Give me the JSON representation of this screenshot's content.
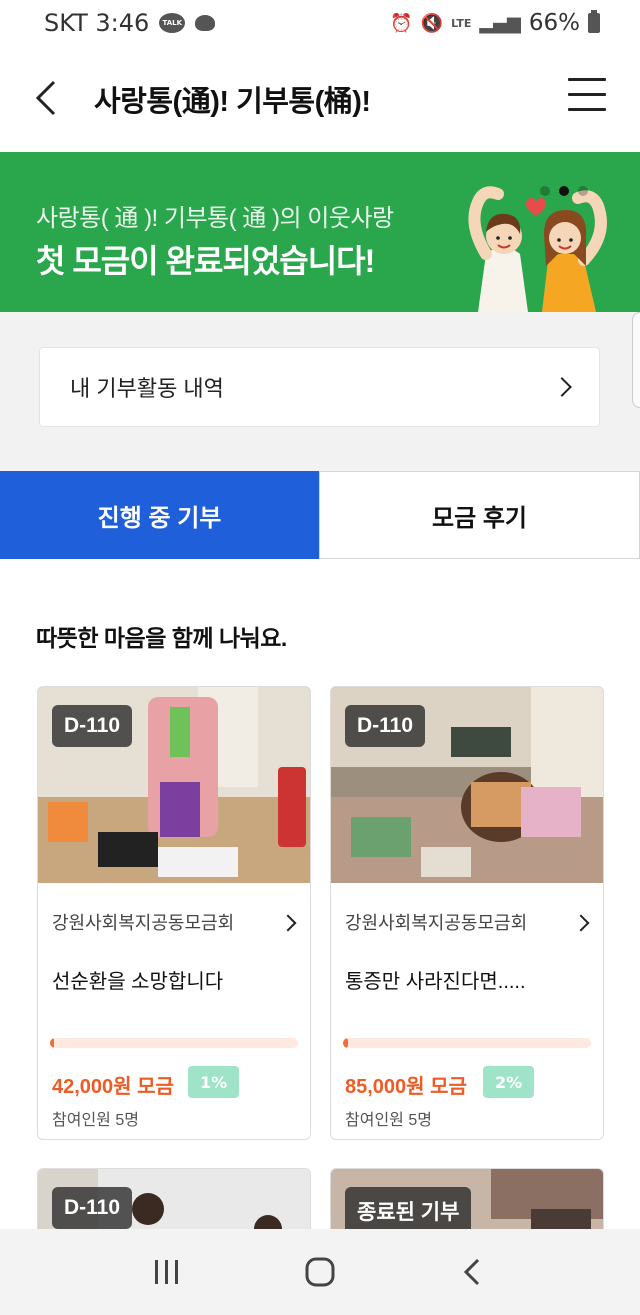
{
  "status_bar": {
    "carrier_time": "SKT 3:46",
    "talk_badge": "TALK",
    "network": "LTE",
    "battery": "66%"
  },
  "header": {
    "title": "사랑통(通)! 기부통(桶)!"
  },
  "banner": {
    "subtitle": "사랑통( 通 )! 기부통( 通 )의 이웃사랑",
    "headline": "첫 모금이 완료되었습니다!",
    "dots_total": 3,
    "dots_active": 2
  },
  "history": {
    "label": "내 기부활동 내역"
  },
  "tabs": [
    {
      "label": "진행 중 기부",
      "active": true
    },
    {
      "label": "모금 후기",
      "active": false
    }
  ],
  "section": {
    "title": "따뜻한 마음을 함께 나눠요."
  },
  "cards": [
    {
      "badge": "D-110",
      "org": "강원사회복지공동모금회",
      "title": "선순환을 소망합니다",
      "progress_fraction": 0.01,
      "amount": "42,000원 모금",
      "percent": "1%",
      "participants": "참여인원 5명"
    },
    {
      "badge": "D-110",
      "org": "강원사회복지공동모금회",
      "title": "통증만 사라진다면.....",
      "progress_fraction": 0.02,
      "amount": "85,000원 모금",
      "percent": "2%",
      "participants": "참여인원 5명"
    },
    {
      "badge": "D-110"
    },
    {
      "badge": "종료된 기부"
    }
  ],
  "colors": {
    "banner_green": "#2aa64c",
    "tab_active_blue": "#1f5fd9",
    "amount_orange": "#ef5b25",
    "percent_mint": "#9fe3c8"
  }
}
